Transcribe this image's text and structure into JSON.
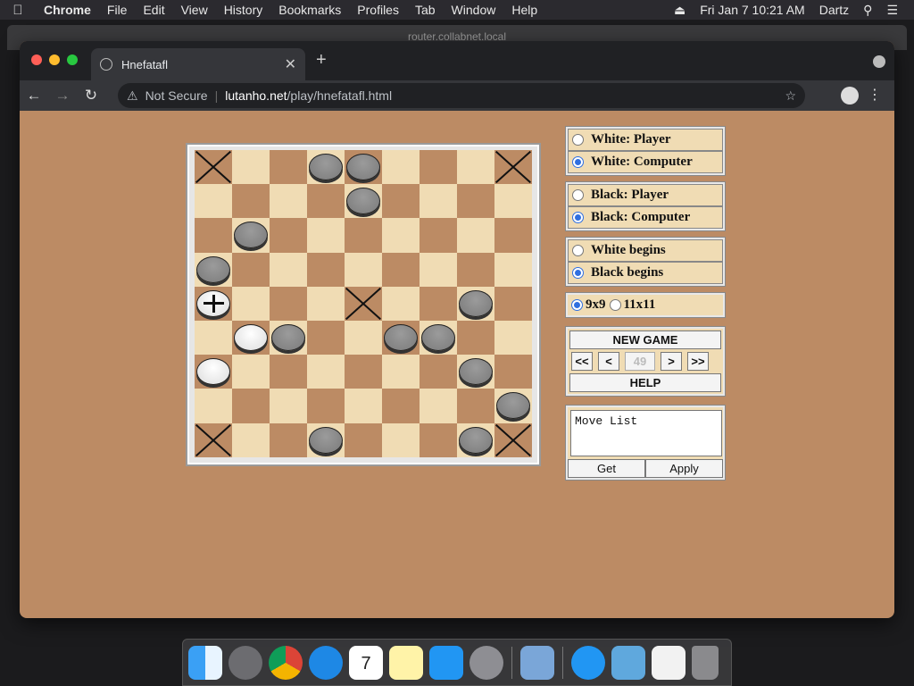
{
  "menubar": {
    "app": "Chrome",
    "items": [
      "File",
      "Edit",
      "View",
      "History",
      "Bookmarks",
      "Profiles",
      "Tab",
      "Window",
      "Help"
    ],
    "datetime": "Fri Jan 7  10:21 AM",
    "user": "Dartz"
  },
  "background_window": {
    "title": "router.collabnet.local"
  },
  "browser": {
    "tab_title": "Hnefatafl",
    "security": "Not Secure",
    "url_host": "lutanho.net",
    "url_path": "/play/hnefatafl.html"
  },
  "board": {
    "size": 9,
    "x_marks": [
      [
        0,
        0
      ],
      [
        0,
        8
      ],
      [
        4,
        4
      ],
      [
        8,
        0
      ],
      [
        8,
        8
      ]
    ],
    "pieces": [
      {
        "r": 0,
        "c": 3,
        "color": "black"
      },
      {
        "r": 0,
        "c": 4,
        "color": "black"
      },
      {
        "r": 1,
        "c": 4,
        "color": "black"
      },
      {
        "r": 2,
        "c": 1,
        "color": "black"
      },
      {
        "r": 3,
        "c": 0,
        "color": "black"
      },
      {
        "r": 4,
        "c": 0,
        "color": "king"
      },
      {
        "r": 4,
        "c": 7,
        "color": "black"
      },
      {
        "r": 5,
        "c": 1,
        "color": "white"
      },
      {
        "r": 5,
        "c": 2,
        "color": "black"
      },
      {
        "r": 5,
        "c": 5,
        "color": "black"
      },
      {
        "r": 5,
        "c": 6,
        "color": "black"
      },
      {
        "r": 6,
        "c": 0,
        "color": "white"
      },
      {
        "r": 6,
        "c": 7,
        "color": "black"
      },
      {
        "r": 7,
        "c": 8,
        "color": "black"
      },
      {
        "r": 8,
        "c": 3,
        "color": "black"
      },
      {
        "r": 8,
        "c": 7,
        "color": "black"
      }
    ]
  },
  "controls": {
    "white_player": "White: Player",
    "white_computer": "White: Computer",
    "black_player": "Black: Player",
    "black_computer": "Black: Computer",
    "white_begins": "White begins",
    "black_begins": "Black begins",
    "size_9": "9x9",
    "size_11": "11x11",
    "new_game": "NEW GAME",
    "first": "<<",
    "prev": "<",
    "move_number": "49",
    "next": ">",
    "last": ">>",
    "help": "HELP",
    "move_list": "Move List",
    "get": "Get",
    "apply": "Apply"
  },
  "dock": {
    "calendar_month": "JAN",
    "calendar_day": "7"
  }
}
